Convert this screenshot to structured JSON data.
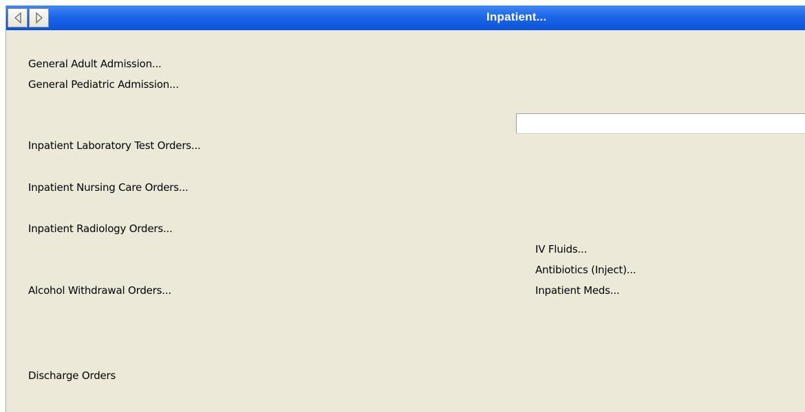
{
  "window": {
    "title": "Inpatient..."
  },
  "nav": {
    "back_icon": "triangle-left",
    "forward_icon": "triangle-right"
  },
  "left_links": [
    "General Adult Admission...",
    "General Pediatric Admission...",
    "Inpatient Laboratory Test Orders...",
    "Inpatient Nursing Care Orders...",
    "Inpatient Radiology Orders...",
    "Alcohol Withdrawal Orders...",
    "Discharge Orders"
  ],
  "right_links": [
    "IV Fluids...",
    "Antibiotics (Inject)...",
    "Inpatient Meds..."
  ],
  "text_field": {
    "value": ""
  },
  "colors": {
    "titlebar": "#0a55dc",
    "panel": "#ece9d8"
  }
}
